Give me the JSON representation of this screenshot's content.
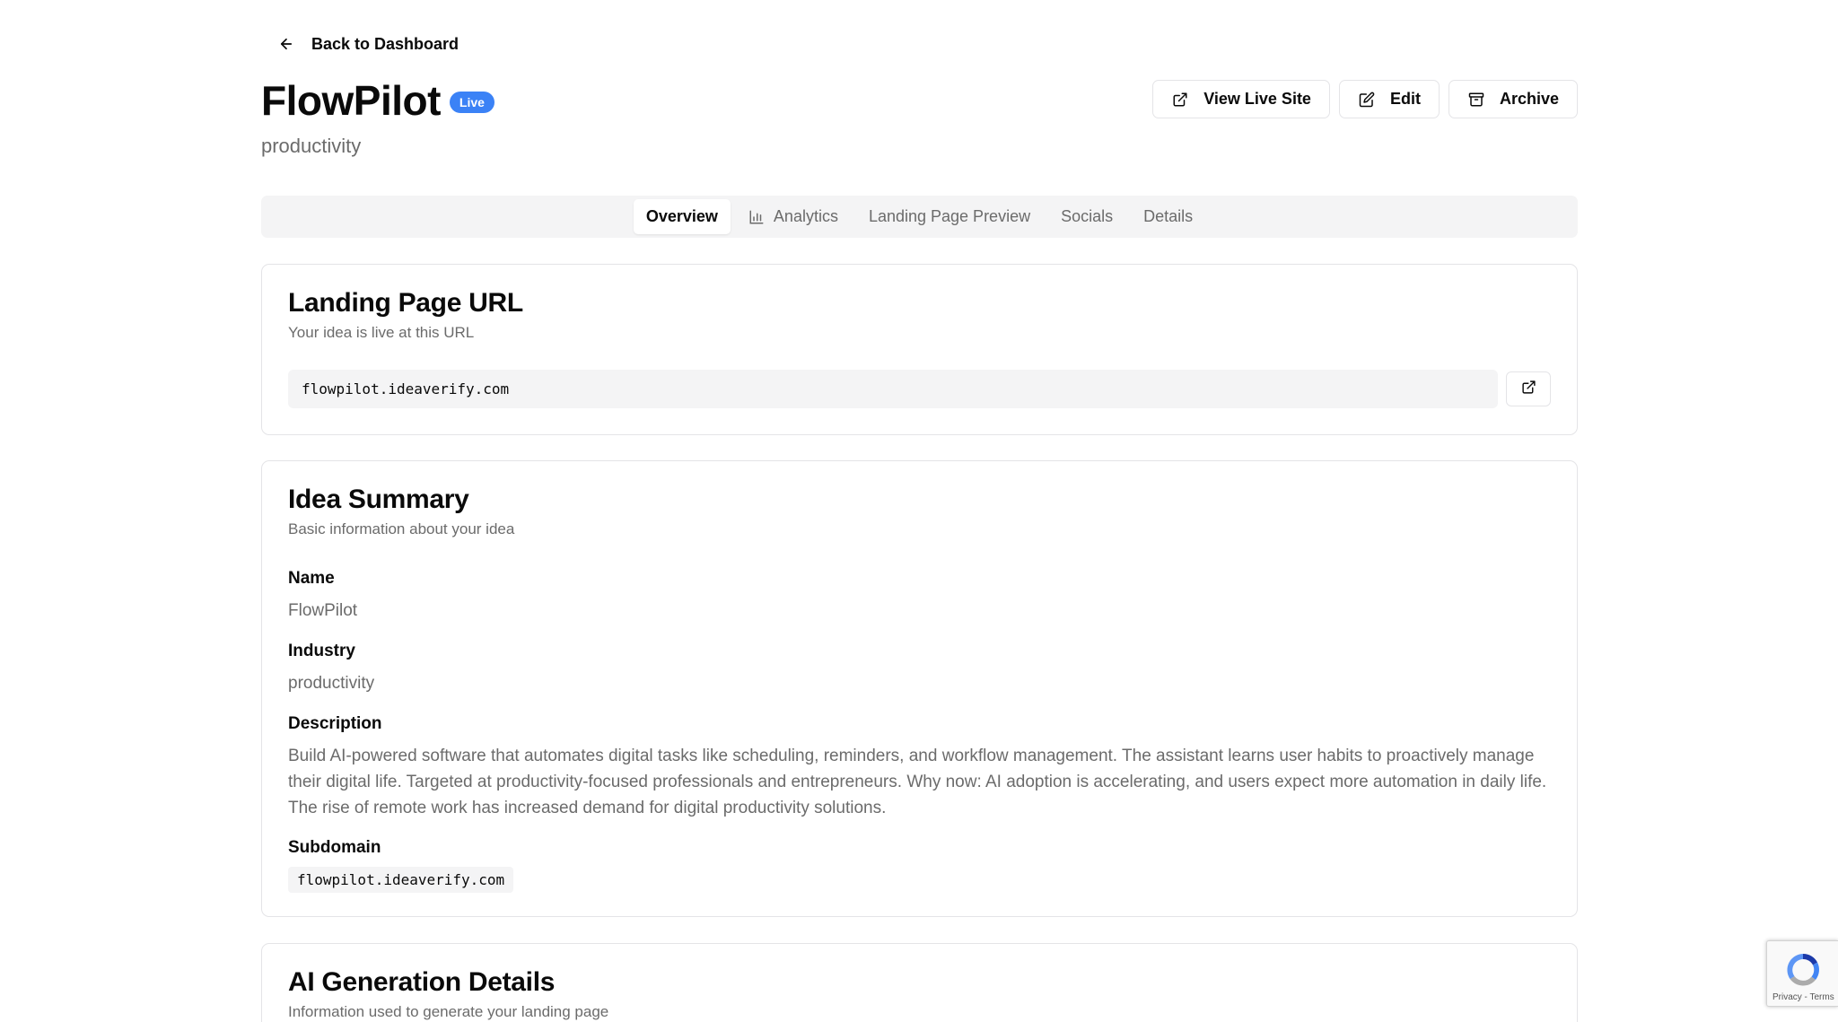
{
  "nav": {
    "back_label": "Back to Dashboard"
  },
  "header": {
    "title": "FlowPilot",
    "status_badge": "Live",
    "subtitle": "productivity",
    "actions": {
      "view_live": "View Live Site",
      "edit": "Edit",
      "archive": "Archive"
    }
  },
  "tabs": [
    {
      "label": "Overview",
      "active": true
    },
    {
      "label": "Analytics",
      "icon": "bar-chart-icon"
    },
    {
      "label": "Landing Page Preview"
    },
    {
      "label": "Socials"
    },
    {
      "label": "Details"
    }
  ],
  "landing_url": {
    "title": "Landing Page URL",
    "description": "Your idea is live at this URL",
    "url": "flowpilot.ideaverify.com"
  },
  "summary": {
    "title": "Idea Summary",
    "description": "Basic information about your idea",
    "name_label": "Name",
    "name_value": "FlowPilot",
    "industry_label": "Industry",
    "industry_value": "productivity",
    "description_label": "Description",
    "description_value": "Build AI-powered software that automates digital tasks like scheduling, reminders, and workflow management. The assistant learns user habits to proactively manage their digital life. Targeted at productivity-focused professionals and entrepreneurs. Why now: AI adoption is accelerating, and users expect more automation in daily life. The rise of remote work has increased demand for digital productivity solutions.",
    "subdomain_label": "Subdomain",
    "subdomain_value": "flowpilot.ideaverify.com"
  },
  "ai_details": {
    "title": "AI Generation Details",
    "description": "Information used to generate your landing page"
  },
  "recaptcha": {
    "terms": "Privacy - Terms"
  },
  "colors": {
    "accent": "#3b82f6",
    "muted_text": "#6b6b6b",
    "border": "#e4e4e7"
  }
}
